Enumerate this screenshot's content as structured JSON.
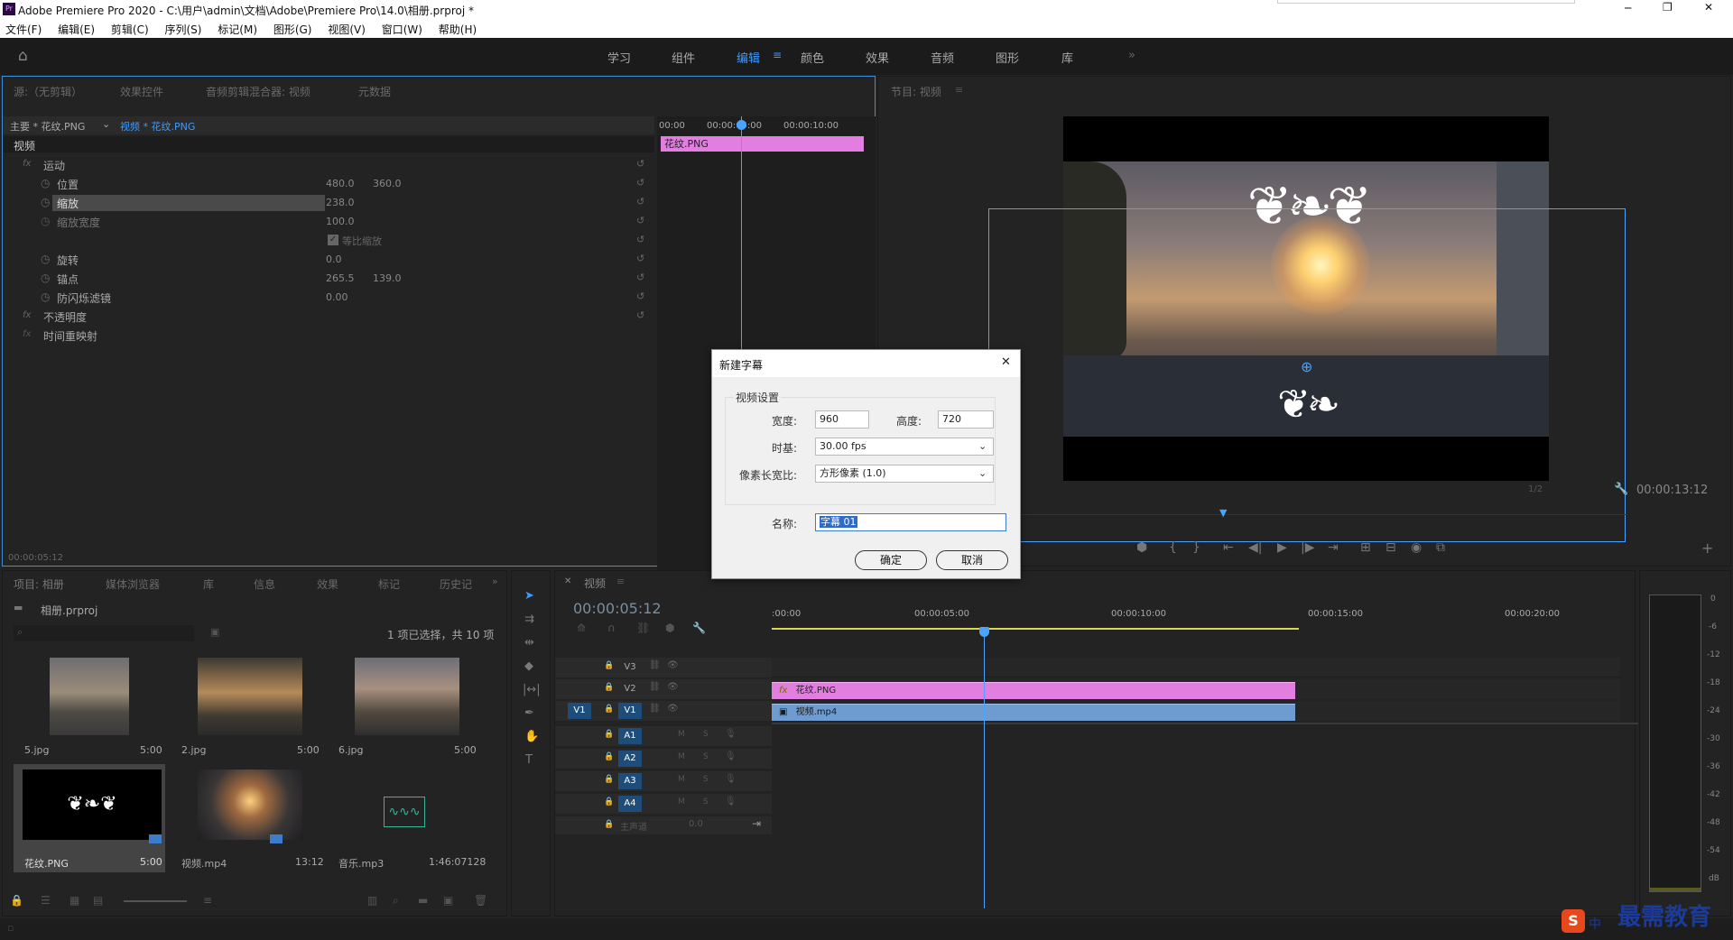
{
  "title_bar": {
    "app_title": "Adobe Premiere Pro 2020 - C:\\用户\\admin\\文档\\Adobe\\Premiere Pro\\14.0\\相册.prproj *",
    "minimize": "─",
    "maximize": "❐",
    "close": "✕"
  },
  "menu": [
    "文件(F)",
    "编辑(E)",
    "剪辑(C)",
    "序列(S)",
    "标记(M)",
    "图形(G)",
    "视图(V)",
    "窗口(W)",
    "帮助(H)"
  ],
  "workspaces": [
    "学习",
    "组件",
    "编辑",
    "颜色",
    "效果",
    "音频",
    "图形",
    "库"
  ],
  "workspace_more": "»",
  "source_tabs": [
    "源:（无剪辑）",
    "效果控件",
    "音频剪辑混合器: 视频",
    "元数据"
  ],
  "effect_controls": {
    "master_clip": "主要 * 花纹.PNG",
    "clip": "视频 * 花纹.PNG",
    "section": "视频",
    "motion": "运动",
    "params": [
      {
        "name": "位置",
        "v1": "480.0",
        "v2": "360.0"
      },
      {
        "name": "缩放",
        "v1": "238.0",
        "v2": ""
      },
      {
        "name": "缩放宽度",
        "v1": "100.0",
        "v2": ""
      },
      {
        "name": "等比缩放",
        "v1": "",
        "v2": ""
      },
      {
        "name": "旋转",
        "v1": "0.0",
        "v2": ""
      },
      {
        "name": "锚点",
        "v1": "265.5",
        "v2": "139.0"
      },
      {
        "name": "防闪烁滤镜",
        "v1": "0.00",
        "v2": ""
      }
    ],
    "opacity": "不透明度",
    "time_remap": "时间重映射",
    "ruler": [
      "00:00",
      "00:00:05:00",
      "00:00:10:00"
    ],
    "clip_bar": "花纹.PNG",
    "timecode": "00:00:05:12"
  },
  "program": {
    "tab": "节目: 视频",
    "timecode": "00:00:13:12",
    "fit": "1/2"
  },
  "dialog": {
    "title": "新建字幕",
    "group": "视频设置",
    "width_label": "宽度:",
    "width": "960",
    "height_label": "高度:",
    "height": "720",
    "timebase_label": "时基:",
    "timebase": "30.00 fps",
    "par_label": "像素长宽比:",
    "par": "方形像素 (1.0)",
    "name_label": "名称:",
    "name": "字幕 01",
    "ok": "确定",
    "cancel": "取消",
    "close": "✕"
  },
  "project": {
    "tabs": [
      "项目: 相册",
      "媒体浏览器",
      "库",
      "信息",
      "效果",
      "标记",
      "历史记"
    ],
    "file": "相册.prproj",
    "selection": "1 项已选择，共 10 项",
    "items": [
      {
        "name": "5.jpg",
        "dur": "5:00"
      },
      {
        "name": "2.jpg",
        "dur": "5:00"
      },
      {
        "name": "6.jpg",
        "dur": "5:00"
      },
      {
        "name": "花纹.PNG",
        "dur": "5:00"
      },
      {
        "name": "视频.mp4",
        "dur": "13:12"
      },
      {
        "name": "音乐.mp3",
        "dur": "1:46:07128"
      }
    ]
  },
  "timeline": {
    "tab": "视频",
    "timecode": "00:00:05:12",
    "ruler": [
      ":00:00",
      "00:00:05:00",
      "00:00:10:00",
      "00:00:15:00",
      "00:00:20:00"
    ],
    "video_tracks": [
      "V3",
      "V2",
      "V1"
    ],
    "audio_tracks": [
      "A1",
      "A2",
      "A3",
      "A4"
    ],
    "master": "主声道",
    "master_val": "0.0",
    "v1_source": "V1",
    "clip_v2": "花纹.PNG",
    "clip_v1": "视频.mp4",
    "colors": {
      "v2_clip": "#e27ee0",
      "v1_clip": "#6e9bd0",
      "playhead": "#4aa3ff"
    }
  },
  "meter": {
    "ticks": [
      "0",
      "-6",
      "-12",
      "-18",
      "-24",
      "-30",
      "-36",
      "-42",
      "-48",
      "-54",
      "dB"
    ]
  },
  "watermark": {
    "brand": "最需教育",
    "ime": "中"
  }
}
